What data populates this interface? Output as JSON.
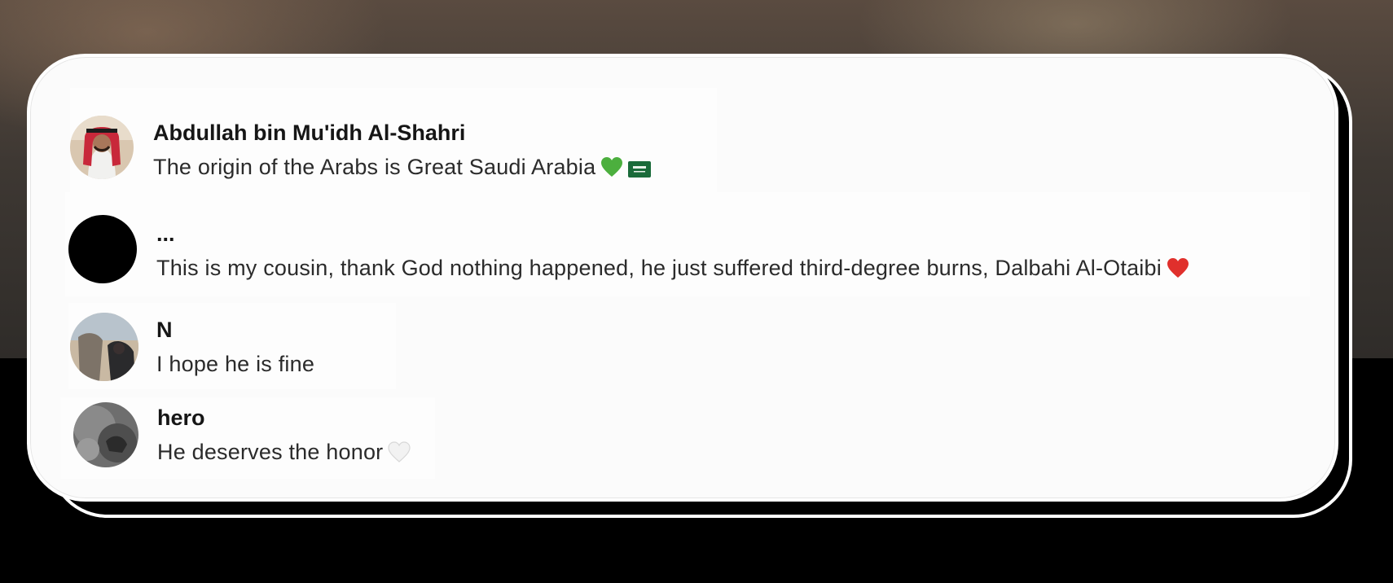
{
  "comments": [
    {
      "author": "Abdullah bin Mu'idh Al-Shahri",
      "text": "The origin of the Arabs is Great Saudi Arabia",
      "emojis": [
        "green-heart-icon",
        "saudi-flag-icon"
      ]
    },
    {
      "author": "...",
      "text": "This is my cousin, thank God nothing happened, he just suffered third-degree burns, Dalbahi Al-Otaibi",
      "emojis": [
        "red-heart-icon"
      ]
    },
    {
      "author": "N",
      "text": "I hope he is fine",
      "emojis": []
    },
    {
      "author": "hero",
      "text": "He deserves the honor",
      "emojis": [
        "white-heart-icon"
      ]
    }
  ],
  "colors": {
    "green_heart": "#4caf3e",
    "red_heart": "#e0302c",
    "saudi_green": "#1a6b3a",
    "white_heart": "#f2f2f2"
  }
}
